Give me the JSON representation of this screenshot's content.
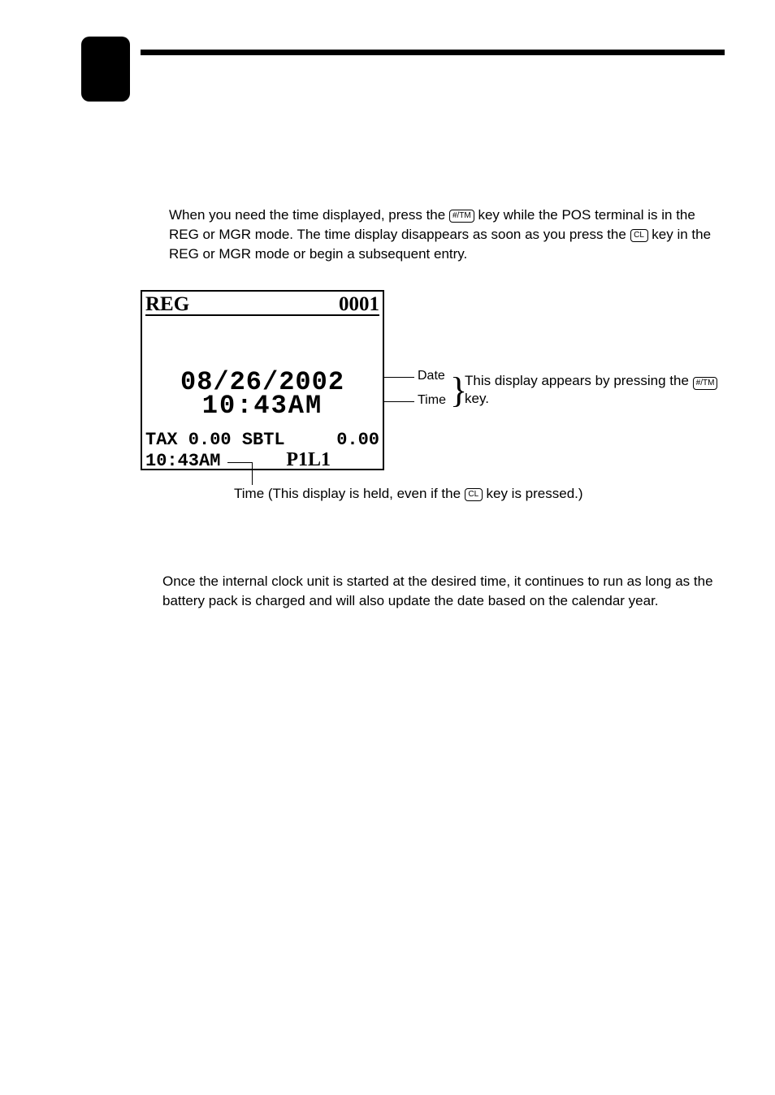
{
  "keys": {
    "tm": "#/TM",
    "cl": "CL"
  },
  "intro": {
    "part1": "When you need the time displayed, press the ",
    "part2": " key while the POS terminal is in the REG or MGR mode. The time display disappears as soon as you press the ",
    "part3": " key in the REG or MGR mode or begin a subsequent entry."
  },
  "lcd": {
    "mode": "REG",
    "num": "0001",
    "date": "08/26/2002",
    "time": "10:43AM",
    "status_left": "TAX 0.00 SBTL",
    "status_right": "0.00",
    "time2": "10:43AM",
    "label": "P1L1"
  },
  "ann": {
    "date_label": "Date",
    "time_label": "Time",
    "appears1": "This display appears by pressing the ",
    "appears2": " key."
  },
  "caption": {
    "part1": "Time (This display is held, even if the ",
    "part2": " key is pressed.)"
  },
  "footnote": "Once the internal clock unit is started at the desired time, it continues to run as long as the battery pack is charged and will also update the date based on the calendar year."
}
